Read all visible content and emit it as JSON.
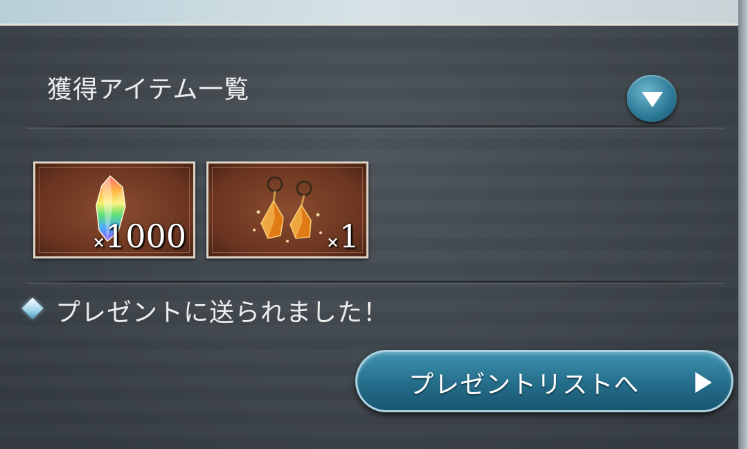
{
  "header": {
    "title": "獲得アイテム一覧"
  },
  "items": [
    {
      "name_icon": "rainbow-crystal-icon",
      "qty_prefix": "×",
      "qty": "1000"
    },
    {
      "name_icon": "amber-earrings-icon",
      "qty_prefix": "×",
      "qty": "1"
    }
  ],
  "message": {
    "text": "プレゼントに送られました！"
  },
  "buttons": {
    "present_list_label": "プレゼントリストへ"
  },
  "colors": {
    "accent": "#2a7894",
    "item_bg": "#6a3420",
    "text": "#eeeeee"
  }
}
